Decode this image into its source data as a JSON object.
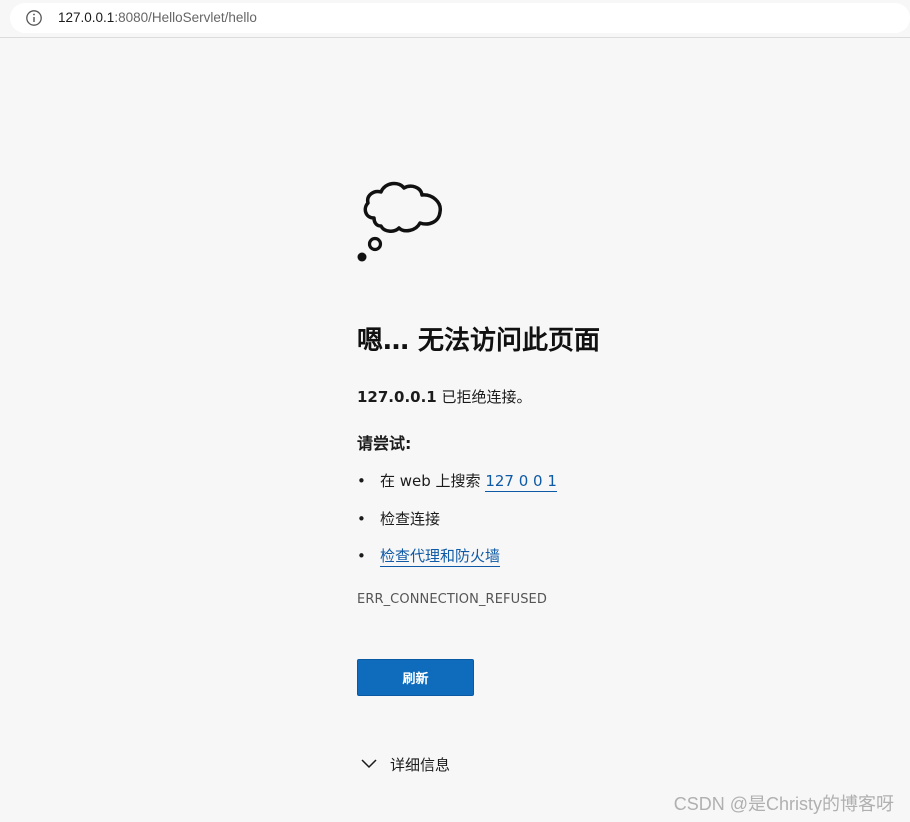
{
  "browser": {
    "url_host": "127.0.0.1",
    "url_rest": ":8080/HelloServlet/hello"
  },
  "error_page": {
    "title": "嗯… 无法访问此页面",
    "host": "127.0.0.1",
    "refused_text": " 已拒绝连接。",
    "try_heading": "请尝试:",
    "suggestions": [
      {
        "prefix": "在 web 上搜索 ",
        "link": "127 0 0 1"
      },
      {
        "prefix": "检查连接",
        "link": ""
      },
      {
        "prefix": "",
        "link": "检查代理和防火墙"
      }
    ],
    "bullet": "•",
    "error_code": "ERR_CONNECTION_REFUSED",
    "refresh_label": "刷新",
    "details_label": "详细信息"
  },
  "watermark": "CSDN @是Christy的博客呀",
  "icons": {
    "info": "info-icon",
    "cloud": "thought-cloud-icon",
    "chevron": "chevron-down-icon"
  },
  "colors": {
    "accent": "#0f6cbd",
    "link": "#0f5aa6",
    "background": "#f7f7f7"
  }
}
